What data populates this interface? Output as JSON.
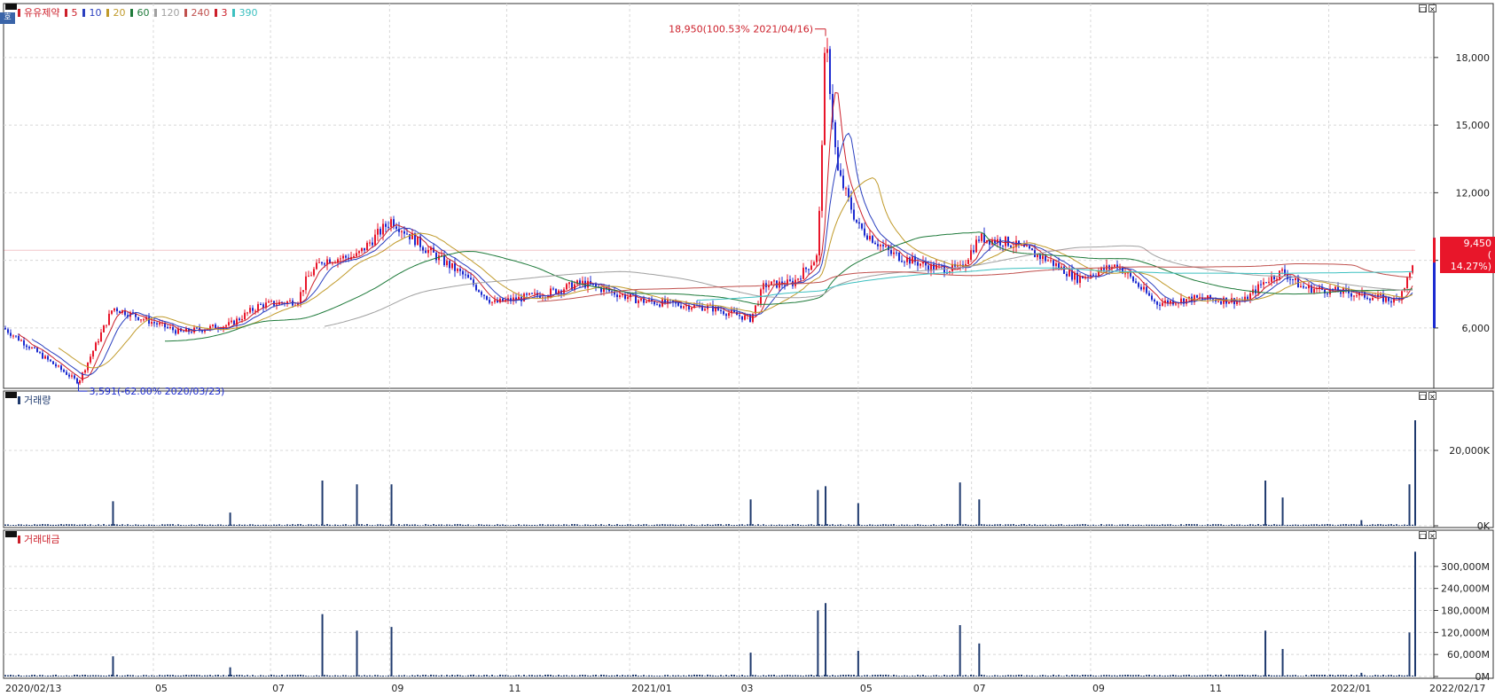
{
  "corner_mark": "호",
  "panels": {
    "price": {
      "legend": [
        {
          "label": "유유제약",
          "color": "#cc1f2a"
        },
        {
          "label": "5",
          "color": "#cc1f2a"
        },
        {
          "label": "10",
          "color": "#2a3fbf"
        },
        {
          "label": "20",
          "color": "#c09a2a"
        },
        {
          "label": "60",
          "color": "#1e7a3a"
        },
        {
          "label": "120",
          "color": "#a0a0a0"
        },
        {
          "label": "240",
          "color": "#c0504d"
        },
        {
          "label": "3",
          "color": "#cc1f2a"
        },
        {
          "label": "390",
          "color": "#3cc0c0"
        }
      ],
      "y_ticks": [
        "18,000",
        "15,000",
        "12,000",
        "9,000",
        "6,000"
      ],
      "high_annotation": "18,950(100.53% 2021/04/16)",
      "low_annotation": "3,591(-62.00% 2020/03/23)",
      "current_price": "9,450",
      "current_change": "( 14.27%)"
    },
    "volume": {
      "legend": [
        {
          "label": "거래량",
          "color": "#1f3a6e"
        }
      ],
      "y_ticks": [
        "20,000K",
        "0K"
      ]
    },
    "amount": {
      "legend": [
        {
          "label": "거래대금",
          "color": "#cc1f2a"
        }
      ],
      "y_ticks": [
        "300,000M",
        "240,000M",
        "180,000M",
        "120,000M",
        "60,000M",
        "0M"
      ]
    }
  },
  "x_labels": [
    "2020/02/13",
    "05",
    "07",
    "09",
    "11",
    "2021/01",
    "03",
    "05",
    "07",
    "09",
    "11",
    "2022/01",
    "2022/02/17"
  ],
  "chart_data": [
    {
      "type": "line",
      "title": "유유제약",
      "x": [
        "2020/02/13",
        "2020/03/23",
        "2020/04/10",
        "2020/05/15",
        "2020/06/10",
        "2020/06/25",
        "2020/07/15",
        "2020/07/20",
        "2020/07/28",
        "2020/08/15",
        "2020/09/02",
        "2020/09/20",
        "2020/10/10",
        "2020/10/25",
        "2020/11/20",
        "2020/12/10",
        "2021/01/10",
        "2021/02/15",
        "2021/03/08",
        "2021/03/15",
        "2021/03/30",
        "2021/04/12",
        "2021/04/16",
        "2021/04/22",
        "2021/05/03",
        "2021/05/20",
        "2021/06/10",
        "2021/06/25",
        "2021/07/05",
        "2021/07/20",
        "2021/08/10",
        "2021/08/25",
        "2021/09/15",
        "2021/10/05",
        "2021/10/25",
        "2021/11/20",
        "2021/12/01",
        "2021/12/10",
        "2021/12/20",
        "2022/01/10",
        "2022/02/07",
        "2022/02/14",
        "2022/02/17"
      ],
      "series": [
        {
          "name": "유유제약",
          "values": [
            6000,
            3591,
            6900,
            5800,
            6150,
            7000,
            7200,
            8200,
            9000,
            9200,
            10800,
            9500,
            8300,
            7100,
            7500,
            8000,
            7200,
            6900,
            6400,
            7900,
            8000,
            9200,
            18950,
            13000,
            10500,
            9300,
            8700,
            8600,
            10000,
            9800,
            9000,
            8200,
            8800,
            7100,
            7300,
            7200,
            8100,
            8500,
            7800,
            7600,
            7200,
            8300,
            9450
          ]
        }
      ],
      "ylim": [
        3400,
        20000
      ],
      "y_ticks": [
        6000,
        9000,
        12000,
        15000,
        18000
      ]
    },
    {
      "type": "bar",
      "title": "거래량",
      "x": [
        "2020/04/10",
        "2020/06/10",
        "2020/07/28",
        "2020/08/15",
        "2020/09/02",
        "2021/03/08",
        "2021/04/12",
        "2021/04/16",
        "2021/05/03",
        "2021/06/25",
        "2021/07/05",
        "2021/12/01",
        "2021/12/10",
        "2022/01/20",
        "2022/02/14",
        "2022/02/17"
      ],
      "series": [
        {
          "name": "거래량",
          "values": [
            6500,
            3500,
            12000,
            11000,
            11000,
            7000,
            9500,
            10500,
            6000,
            11500,
            7000,
            12000,
            7500,
            1500,
            11000,
            28000
          ]
        }
      ],
      "ylim": [
        0,
        32000
      ],
      "y_ticks": [
        0,
        20000
      ]
    },
    {
      "type": "bar",
      "title": "거래대금",
      "x": [
        "2020/04/10",
        "2020/06/10",
        "2020/07/28",
        "2020/08/15",
        "2020/09/02",
        "2021/03/08",
        "2021/04/12",
        "2021/04/16",
        "2021/05/03",
        "2021/06/25",
        "2021/07/05",
        "2021/12/01",
        "2021/12/10",
        "2022/01/20",
        "2022/02/14",
        "2022/02/17"
      ],
      "series": [
        {
          "name": "거래대금",
          "values": [
            55000,
            25000,
            170000,
            125000,
            135000,
            65000,
            180000,
            200000,
            70000,
            140000,
            90000,
            125000,
            75000,
            10000,
            120000,
            340000
          ]
        }
      ],
      "ylim": [
        0,
        360000
      ],
      "y_ticks": [
        0,
        60000,
        120000,
        180000,
        240000,
        300000
      ]
    }
  ]
}
